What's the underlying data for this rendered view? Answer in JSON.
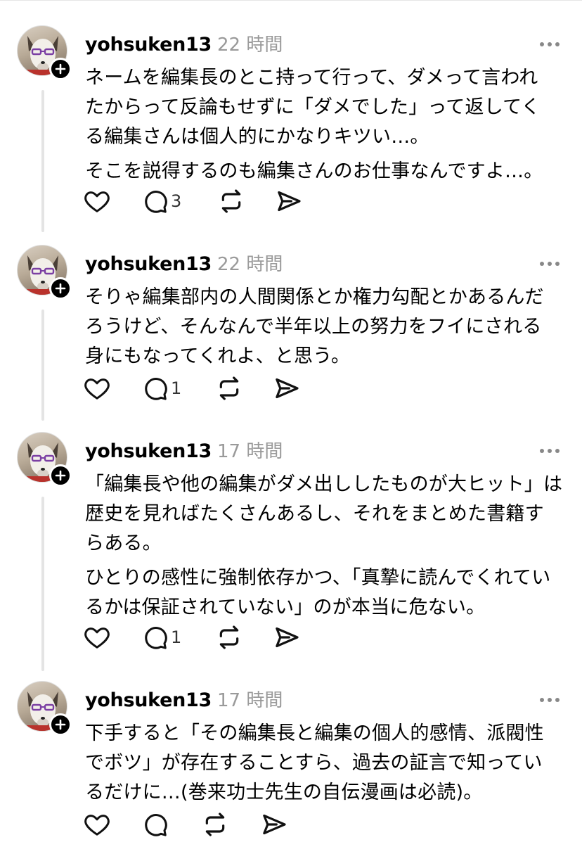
{
  "posts": [
    {
      "username": "yohsuken13",
      "time": "22 時間",
      "paragraphs": [
        "ネームを編集長のとこ持って行って、ダメって言われ\nたからって反論もせずに「ダメでした」って返してく\nる編集さんは個人的にかなりキツい…。",
        "そこを説得するのも編集さんのお仕事なんですよ…。"
      ],
      "reply_count": "3"
    },
    {
      "username": "yohsuken13",
      "time": "22 時間",
      "paragraphs": [
        "そりゃ編集部内の人間関係とか権力勾配とかあるんだ\nろうけど、そんなんで半年以上の努力をフイにされる\n身にもなってくれよ、と思う。"
      ],
      "reply_count": "1"
    },
    {
      "username": "yohsuken13",
      "time": "17 時間",
      "paragraphs": [
        "「編集長や他の編集がダメ出ししたものが大ヒット」は\n歴史を見ればたくさんあるし、それをまとめた書籍す\nらある。",
        "ひとりの感性に強制依存かつ、「真摯に読んでくれてい\nるかは保証されていない」のが本当に危ない。"
      ],
      "reply_count": "1"
    },
    {
      "username": "yohsuken13",
      "time": "17 時間",
      "paragraphs": [
        "下手すると「その編集長と編集の個人的感情、派閥性\nでボツ」が存在することすら、過去の証言で知ってい\nるだけに…(巻来功士先生の自伝漫画は必読)。"
      ],
      "reply_count": ""
    }
  ],
  "icons": {
    "like": "heart-icon",
    "reply": "reply-bubble-icon",
    "repost": "repost-icon",
    "share": "send-icon",
    "more": "more-dots-icon",
    "follow": "plus-icon"
  },
  "colors": {
    "text": "#000000",
    "muted": "#9a9a9a",
    "thread_line": "#e4e4e4"
  }
}
